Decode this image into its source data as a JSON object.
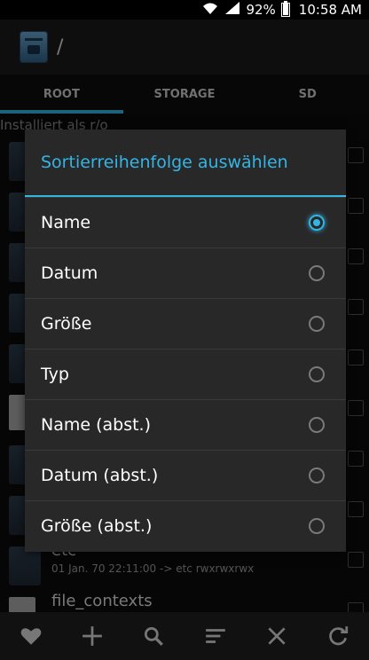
{
  "status_bar": {
    "battery_percent": "92%",
    "time": "10:58 AM"
  },
  "header": {
    "path": "/"
  },
  "tabs": [
    {
      "label": "ROOT",
      "active": true
    },
    {
      "label": "STORAGE",
      "active": false
    },
    {
      "label": "SD",
      "active": false
    }
  ],
  "background_list": {
    "mount_note": "Installiert als r/o",
    "rows": [
      {
        "name": "etc",
        "meta": "01 Jan. 70 22:11:00  -> etc  rwxrwxrwx"
      },
      {
        "name": "file_contexts",
        "meta": ""
      }
    ]
  },
  "dialog": {
    "title": "Sortierreihenfolge auswählen",
    "options": [
      {
        "label": "Name",
        "selected": true
      },
      {
        "label": "Datum",
        "selected": false
      },
      {
        "label": "Größe",
        "selected": false
      },
      {
        "label": "Typ",
        "selected": false
      },
      {
        "label": "Name (abst.)",
        "selected": false
      },
      {
        "label": "Datum (abst.)",
        "selected": false
      },
      {
        "label": "Größe (abst.)",
        "selected": false
      }
    ]
  },
  "bottom_bar": [
    "heart-icon",
    "plus-icon",
    "search-icon",
    "sort-icon",
    "close-icon",
    "refresh-icon"
  ],
  "colors": {
    "accent": "#33b5e5",
    "dialog_bg": "#282828"
  }
}
